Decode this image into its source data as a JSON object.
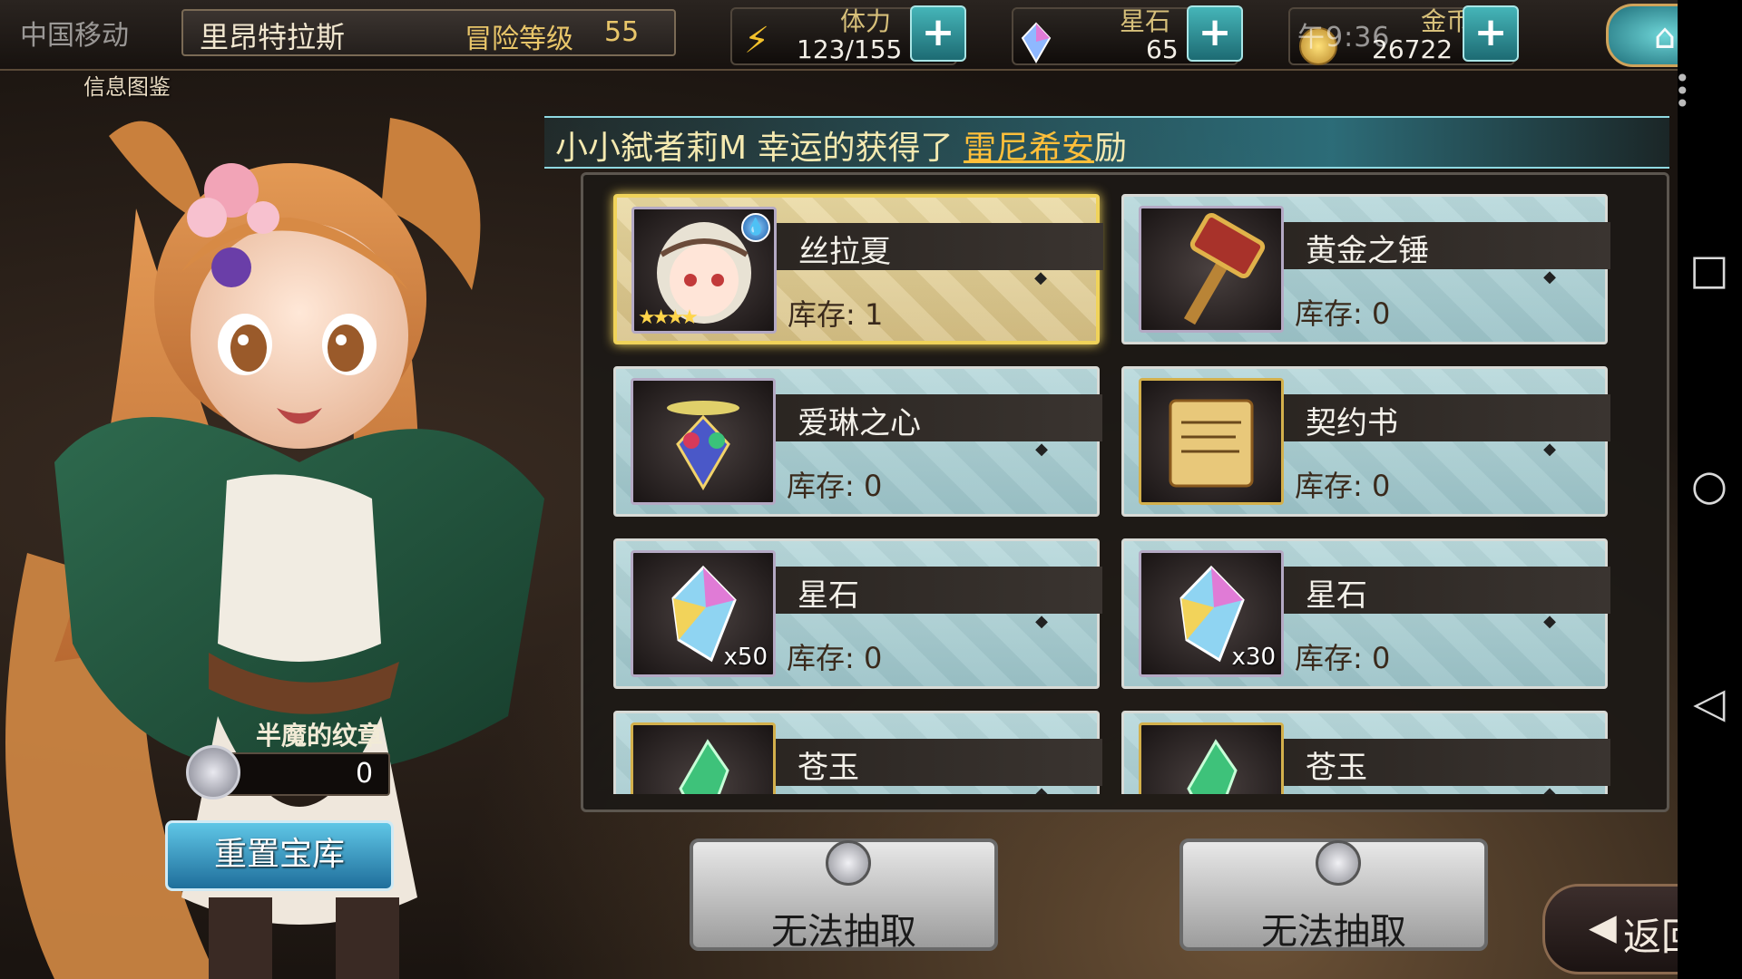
{
  "status_bar": {
    "carrier": "中国移动",
    "time_fragment": "午9:36"
  },
  "header": {
    "player_name": "里昂特拉斯",
    "adventure_label": "冒险等级",
    "adventure_level": "55",
    "stamina": {
      "label": "体力",
      "value": "123/155",
      "icon": "lightning-icon"
    },
    "star_stone": {
      "label": "星石",
      "value": "65",
      "icon": "crystal-icon"
    },
    "gold": {
      "label": "金币",
      "value": "26722",
      "icon": "gold-coin-icon"
    },
    "plus_label": "+",
    "home_icon": "home-icon"
  },
  "info_book_label": "信息图鉴",
  "banner": {
    "prefix": "小小弑者莉M 幸运的获得了 ",
    "highlight": "雷尼希安",
    "suffix": "励"
  },
  "pool": {
    "stock_label": "库存:",
    "items": [
      {
        "name": "丝拉夏",
        "stock": "1",
        "icon": "character-portrait-icon",
        "stars": "★★★★",
        "qty": "",
        "selected": true
      },
      {
        "name": "黄金之锤",
        "stock": "0",
        "icon": "hammer-icon",
        "stars": "",
        "qty": "",
        "selected": false
      },
      {
        "name": "爱琳之心",
        "stock": "0",
        "icon": "heart-gem-icon",
        "stars": "",
        "qty": "",
        "selected": false
      },
      {
        "name": "契约书",
        "stock": "0",
        "icon": "scroll-icon",
        "stars": "",
        "qty": "",
        "selected": false
      },
      {
        "name": "星石",
        "stock": "0",
        "icon": "crystal-icon",
        "stars": "",
        "qty": "x50",
        "selected": false
      },
      {
        "name": "星石",
        "stock": "0",
        "icon": "crystal-icon",
        "stars": "",
        "qty": "x30",
        "selected": false
      },
      {
        "name": "苍玉",
        "stock": "",
        "icon": "jade-icon",
        "stars": "",
        "qty": "",
        "selected": false
      },
      {
        "name": "苍玉",
        "stock": "",
        "icon": "jade-icon",
        "stars": "",
        "qty": "",
        "selected": false
      }
    ]
  },
  "emblem": {
    "title": "半魔的纹章",
    "value": "0"
  },
  "buttons": {
    "reset": "重置宝库",
    "draw_left": "无法抽取",
    "draw_right": "无法抽取",
    "back": "返回"
  }
}
